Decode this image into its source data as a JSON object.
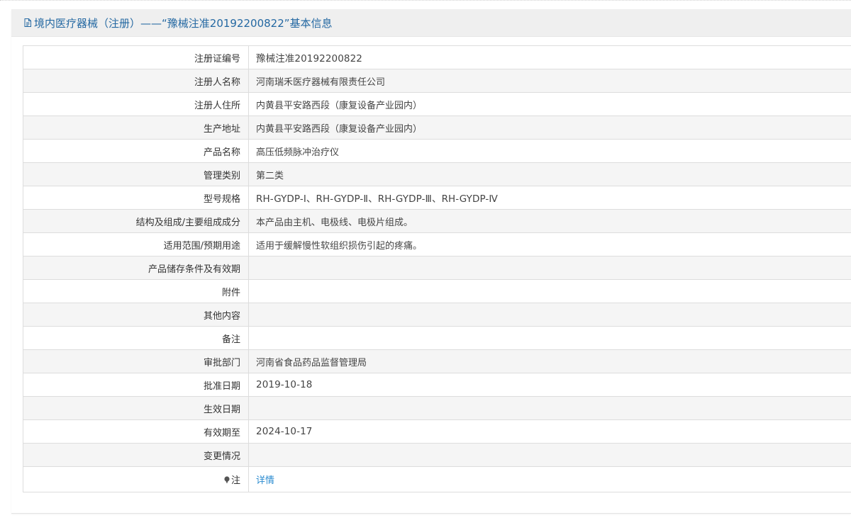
{
  "header": {
    "title": "境内医疗器械（注册）——“豫械注准20192200822”基本信息"
  },
  "rows": [
    {
      "label": "注册证编号",
      "value": "豫械注准20192200822"
    },
    {
      "label": "注册人名称",
      "value": "河南瑞禾医疗器械有限责任公司"
    },
    {
      "label": "注册人住所",
      "value": "内黄县平安路西段（康复设备产业园内）"
    },
    {
      "label": "生产地址",
      "value": "内黄县平安路西段（康复设备产业园内）"
    },
    {
      "label": "产品名称",
      "value": "高压低频脉冲治疗仪"
    },
    {
      "label": "管理类别",
      "value": "第二类"
    },
    {
      "label": "型号规格",
      "value": "RH-GYDP-Ⅰ、RH-GYDP-Ⅱ、RH-GYDP-Ⅲ、RH-GYDP-Ⅳ"
    },
    {
      "label": "结构及组成/主要组成成分",
      "value": "本产品由主机、电极线、电极片组成。"
    },
    {
      "label": "适用范围/预期用途",
      "value": "适用于缓解慢性软组织损伤引起的疼痛。"
    },
    {
      "label": "产品储存条件及有效期",
      "value": ""
    },
    {
      "label": "附件",
      "value": ""
    },
    {
      "label": "其他内容",
      "value": ""
    },
    {
      "label": "备注",
      "value": ""
    },
    {
      "label": "审批部门",
      "value": "河南省食品药品监督管理局"
    },
    {
      "label": "批准日期",
      "value": "2019-10-18"
    },
    {
      "label": "生效日期",
      "value": ""
    },
    {
      "label": "有效期至",
      "value": "2024-10-17"
    },
    {
      "label": "变更情况",
      "value": ""
    }
  ],
  "note": {
    "label": "注",
    "link_text": "详情",
    "icon": "pin-icon"
  },
  "colors": {
    "title": "#2468a2",
    "link": "#2a8bd0",
    "header_bg": "#efefef",
    "stripe_bg": "#f5f5f5",
    "border": "#dddddd"
  }
}
